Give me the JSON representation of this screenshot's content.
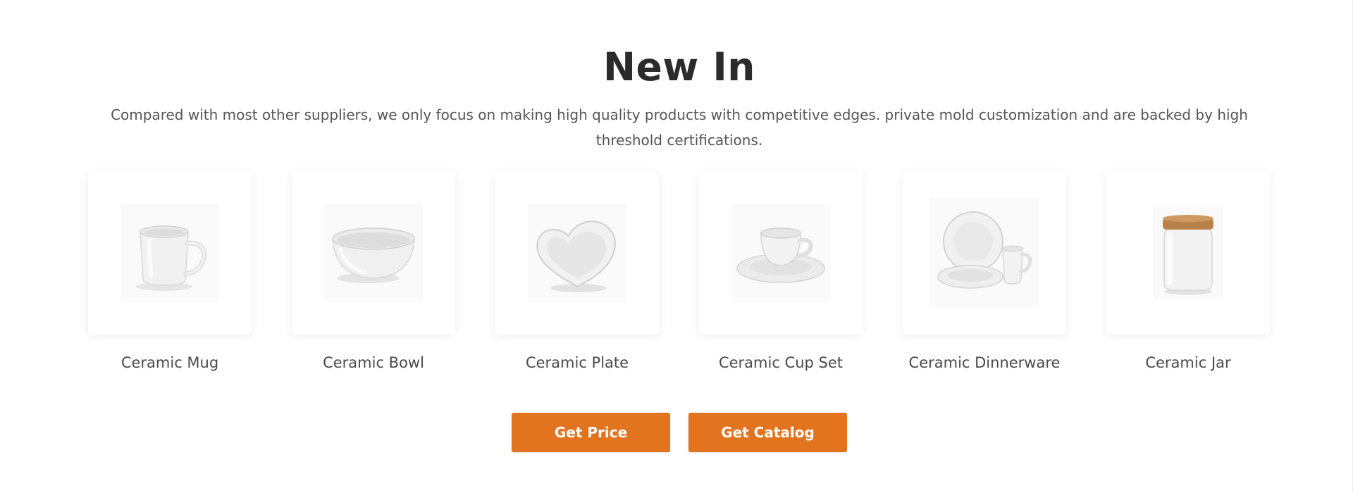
{
  "section": {
    "title": "New In",
    "description": "Compared with most other suppliers, we only focus on making high quality products with competitive edges. private  mold customization and are backed by high threshold certifications."
  },
  "products": [
    {
      "name": "Ceramic Mug",
      "icon": "mug-icon"
    },
    {
      "name": "Ceramic Bowl",
      "icon": "bowl-icon"
    },
    {
      "name": "Ceramic Plate",
      "icon": "heart-plate-icon"
    },
    {
      "name": "Ceramic Cup Set",
      "icon": "cup-saucer-icon"
    },
    {
      "name": "Ceramic Dinnerware",
      "icon": "dinnerware-icon"
    },
    {
      "name": "Ceramic Jar",
      "icon": "jar-icon"
    }
  ],
  "buttons": {
    "get_price": "Get Price",
    "get_catalog": "Get Catalog"
  },
  "colors": {
    "accent": "#e2731f",
    "title": "#2b2b2b",
    "text": "#555555",
    "jar_lid": "#b9824a"
  }
}
